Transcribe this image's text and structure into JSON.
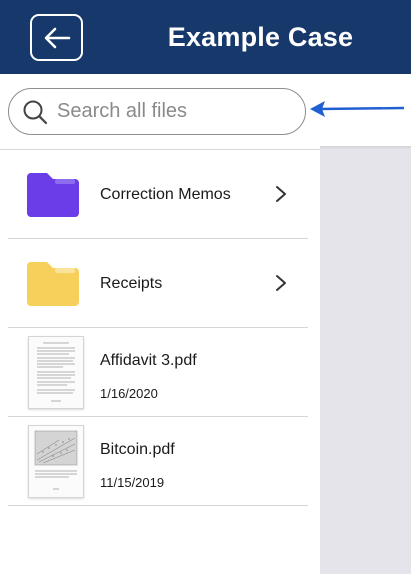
{
  "header": {
    "title": "Example Case",
    "background": "#16386a",
    "back_icon": "arrow-left-icon"
  },
  "search": {
    "placeholder": "Search all files",
    "value": "",
    "icon": "search-icon"
  },
  "annotation": {
    "arrow_color": "#1f5fd1"
  },
  "items": [
    {
      "type": "folder",
      "label": "Correction Memos",
      "icon": "folder-icon",
      "color": "#6a3de8"
    },
    {
      "type": "folder",
      "label": "Receipts",
      "icon": "folder-icon",
      "color": "#f7cf5b"
    },
    {
      "type": "file",
      "label": "Affidavit 3.pdf",
      "date": "1/16/2020",
      "icon": "pdf-thumbnail"
    },
    {
      "type": "file",
      "label": "Bitcoin.pdf",
      "date": "11/15/2019",
      "icon": "pdf-thumbnail"
    }
  ],
  "colors": {
    "panel_bg": "#e6e4eb",
    "divider": "#d6d6d6"
  }
}
